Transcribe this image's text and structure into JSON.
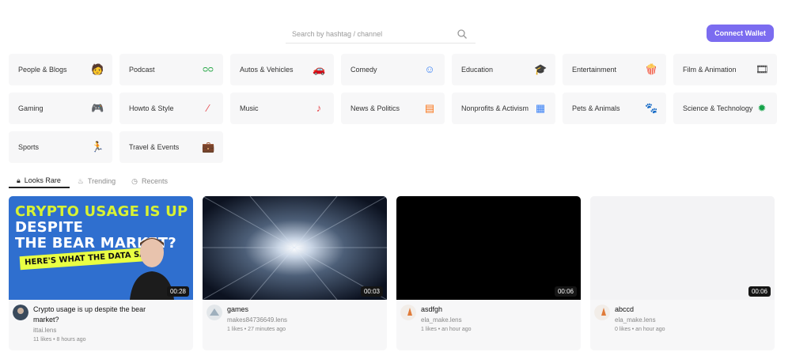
{
  "search": {
    "placeholder": "Search by hashtag / channel"
  },
  "header": {
    "connect_label": "Connect Wallet"
  },
  "categories": [
    {
      "label": "People & Blogs",
      "icon": "person-icon"
    },
    {
      "label": "Podcast",
      "icon": "podcast-icon"
    },
    {
      "label": "Autos & Vehicles",
      "icon": "car-icon"
    },
    {
      "label": "Comedy",
      "icon": "smile-icon"
    },
    {
      "label": "Education",
      "icon": "graduation-cap-icon"
    },
    {
      "label": "Entertainment",
      "icon": "popcorn-icon"
    },
    {
      "label": "Film & Animation",
      "icon": "film-icon"
    },
    {
      "label": "Gaming",
      "icon": "gamepad-icon"
    },
    {
      "label": "Howto & Style",
      "icon": "brush-icon"
    },
    {
      "label": "Music",
      "icon": "music-note-icon"
    },
    {
      "label": "News & Politics",
      "icon": "newspaper-icon"
    },
    {
      "label": "Nonprofits & Activism",
      "icon": "building-icon"
    },
    {
      "label": "Pets & Animals",
      "icon": "paw-icon"
    },
    {
      "label": "Science & Technology",
      "icon": "microbe-icon"
    },
    {
      "label": "Sports",
      "icon": "runner-icon"
    },
    {
      "label": "Travel & Events",
      "icon": "suitcase-icon"
    }
  ],
  "tabs": [
    {
      "label": "Looks Rare",
      "icon": "lock-icon",
      "active": true
    },
    {
      "label": "Trending",
      "icon": "flame-icon",
      "active": false
    },
    {
      "label": "Recents",
      "icon": "clock-icon",
      "active": false
    }
  ],
  "videos": [
    {
      "title": "Crypto usage is up despite the bear market?",
      "handle": "ittai.lens",
      "stats": "11 likes • 8 hours ago",
      "duration": "00:28",
      "thumb_text": {
        "line1a": "CRYPTO USAGE IS UP",
        "line1b": " DESPITE",
        "line2": "THE BEAR MARKET?",
        "banner": "HERE'S WHAT THE DATA SAYS"
      }
    },
    {
      "title": "games",
      "handle": "makes84736649.lens",
      "stats": "1 likes • 27 minutes ago",
      "duration": "00:03"
    },
    {
      "title": "asdfgh",
      "handle": "ela_make.lens",
      "stats": "1 likes • an hour ago",
      "duration": "00:06"
    },
    {
      "title": "abccd",
      "handle": "ela_make.lens",
      "stats": "0 likes • an hour ago",
      "duration": "00:06"
    }
  ],
  "colors": {
    "accent": "#7b6cf0"
  }
}
